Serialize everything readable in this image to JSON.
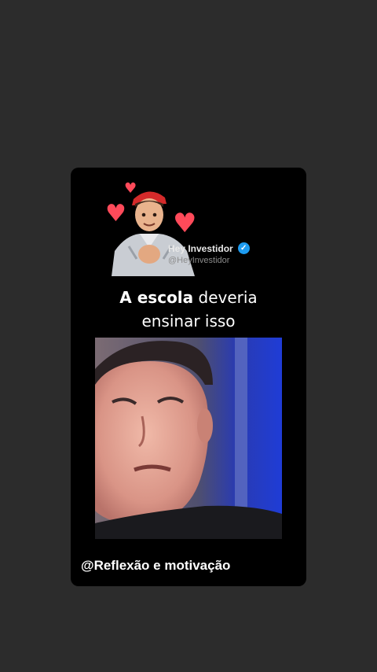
{
  "profile": {
    "name": "Hey Investidor",
    "handle": "@HeyInvestidor",
    "verified_icon": "verified-badge-icon"
  },
  "headline": {
    "bold": "A escola",
    "rest_line1": "deveria",
    "line2": "ensinar isso"
  },
  "video": {
    "subject": "man-speaking"
  },
  "caption": "@Reflexão e motivação",
  "colors": {
    "background": "#2c2c2c",
    "card": "#000000",
    "heart": "#ff4a5a",
    "verified": "#1d9bf0",
    "video_blue": "#1f3cd6"
  }
}
